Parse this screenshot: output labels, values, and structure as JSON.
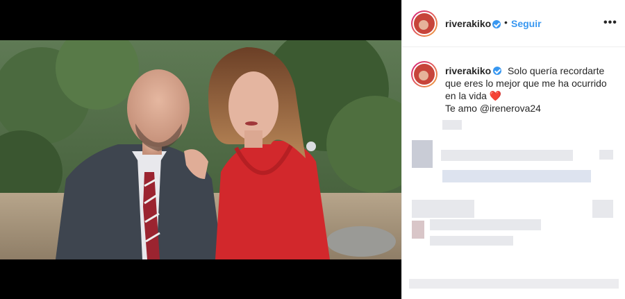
{
  "post": {
    "username": "riverakiko",
    "follow_separator": "•",
    "follow_label": "Seguir",
    "more_label": "•••",
    "caption_lines": [
      "Solo quería recordarte",
      "que eres lo mejor que me ha ocurrido",
      "en la vida"
    ],
    "heart": "❤️",
    "love_prefix": "Te amo",
    "mention": "@irenerova24"
  },
  "colors": {
    "accent_blue": "#3897f0",
    "heart_red": "#ed1c24",
    "text": "#262626"
  },
  "icons": [
    "verified-icon",
    "more-icon",
    "avatar-icon"
  ]
}
